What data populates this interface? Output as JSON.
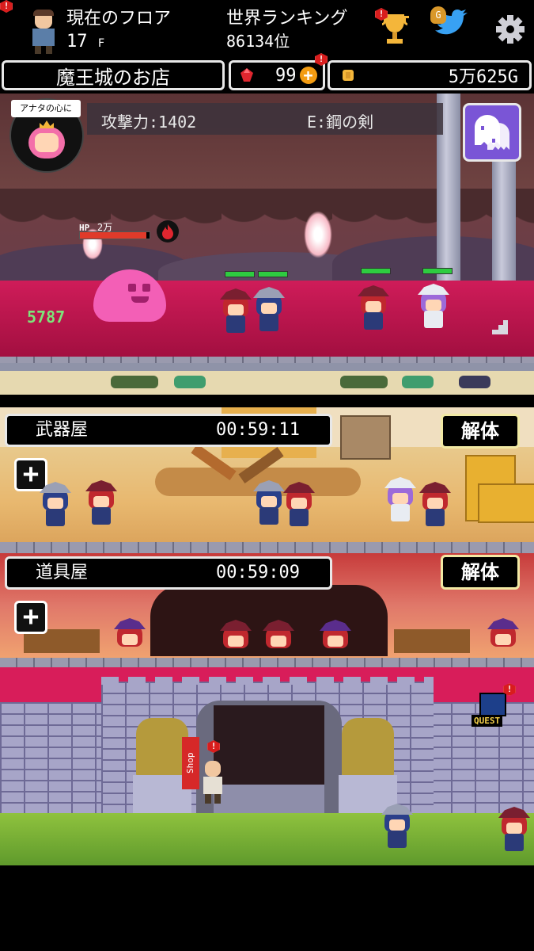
{
  "status": {
    "floor_label": "現在のフロア",
    "floor_value": "17",
    "floor_unit": "F",
    "ranking_label": "世界ランキング",
    "ranking_value": "86134位",
    "notification_mark": "!"
  },
  "info_bar": {
    "shop_name": "魔王城のお店",
    "gems": "99",
    "gold": "5万625G"
  },
  "battle": {
    "speech_bubble": "アナタの心に",
    "attack_label": "攻撃力:1402",
    "equipment_label": "E:鋼の剣",
    "enemy_hp_label": "HP",
    "enemy_hp_value": "2万",
    "enemy_hp_fraction": 0.95,
    "damage_number": "5787"
  },
  "shops": [
    {
      "name": "武器屋",
      "timer": "00:59:11",
      "dismantle_label": "解体",
      "add_label": "+"
    },
    {
      "name": "道具屋",
      "timer": "00:59:09",
      "dismantle_label": "解体",
      "add_label": "+"
    }
  ],
  "castle": {
    "quest_label": "QUEST",
    "shop_banner": "Shop"
  },
  "colors": {
    "accent_red": "#d81d1d",
    "floor_pink": "#cf1c59",
    "hp_green": "#2ecc40",
    "gold": "#f4b63a"
  }
}
